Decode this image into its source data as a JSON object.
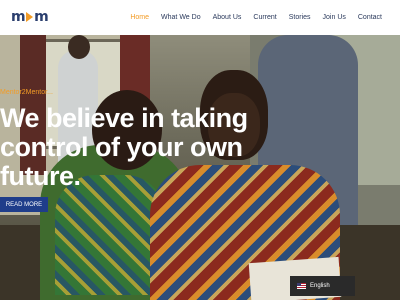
{
  "brand": {
    "logo_left": "m",
    "logo_right": "m"
  },
  "nav": {
    "items": [
      {
        "label": "Home",
        "active": true
      },
      {
        "label": "What We Do",
        "active": false
      },
      {
        "label": "About Us",
        "active": false
      },
      {
        "label": "Current",
        "active": false
      },
      {
        "label": "Stories",
        "active": false
      },
      {
        "label": "Join Us",
        "active": false
      },
      {
        "label": "Contact",
        "active": false
      }
    ]
  },
  "hero": {
    "tagline": "Mentor2Mentor...",
    "headline_lines": [
      "We believe in taking",
      "control of your own",
      "future."
    ],
    "cta_label": "READ MORE"
  },
  "language": {
    "label": "English",
    "flag": "us-flag-icon"
  },
  "colors": {
    "accent": "#f39c26",
    "brand": "#2b3f6e",
    "button": "#1f3d8a"
  }
}
